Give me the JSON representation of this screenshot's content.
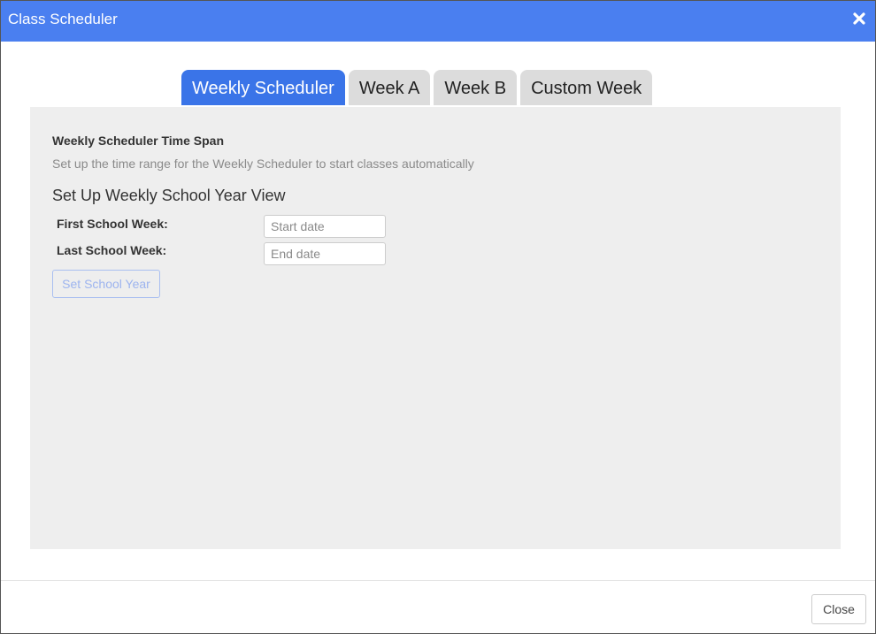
{
  "window": {
    "title": "Class Scheduler",
    "close_icon": "close-icon",
    "accent_color": "#4a7ff0"
  },
  "tabs": [
    {
      "label": "Weekly Scheduler",
      "active": true
    },
    {
      "label": "Week A",
      "active": false
    },
    {
      "label": "Week B",
      "active": false
    },
    {
      "label": "Custom Week",
      "active": false
    }
  ],
  "panel": {
    "heading": "Weekly Scheduler Time Span",
    "description": "Set up the time range for the Weekly Scheduler to start classes automatically",
    "subheading": "Set Up Weekly School Year View",
    "first_week": {
      "label": "First School Week:",
      "value": "",
      "placeholder": "Start date"
    },
    "last_week": {
      "label": "Last School Week:",
      "value": "",
      "placeholder": "End date"
    },
    "set_button_label": "Set School Year"
  },
  "footer": {
    "close_label": "Close"
  }
}
